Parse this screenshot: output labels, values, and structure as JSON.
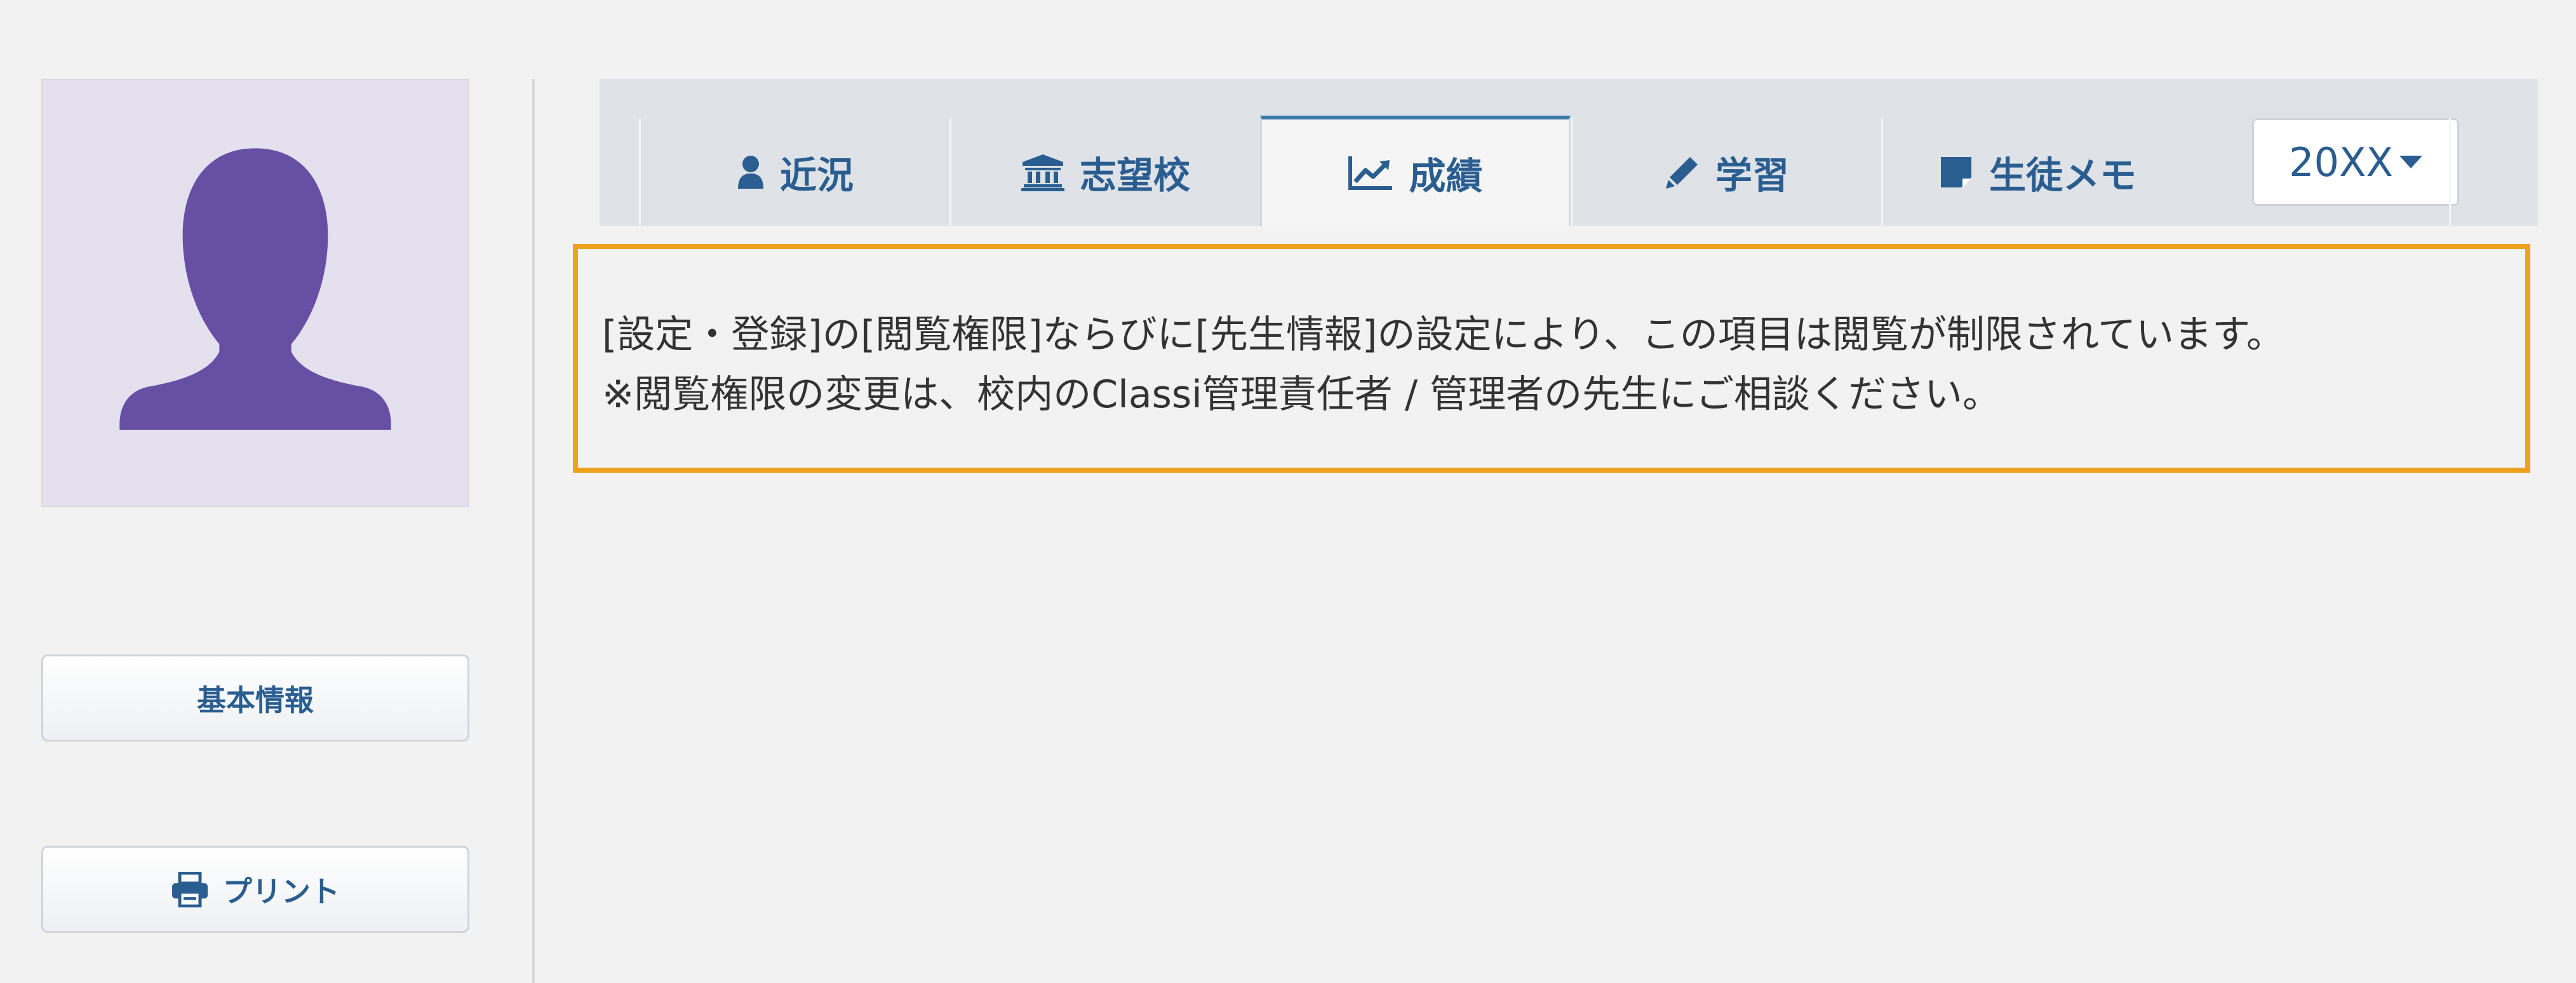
{
  "sidebar": {
    "avatar_icon": "person-silhouette-icon",
    "basic_info_label": "基本情報",
    "print_label": "プリント",
    "print_icon": "printer-icon"
  },
  "tabs": [
    {
      "label": "近況",
      "icon": "user-icon",
      "active": false
    },
    {
      "label": "志望校",
      "icon": "institution-icon",
      "active": false
    },
    {
      "label": "成績",
      "icon": "line-chart-icon",
      "active": true
    },
    {
      "label": "学習",
      "icon": "pencil-icon",
      "active": false
    },
    {
      "label": "生徒メモ",
      "icon": "sticky-note-icon",
      "active": false
    }
  ],
  "year_select": {
    "value": "20XX"
  },
  "notice": {
    "line1": "[設定・登録]の[閲覧権限]ならびに[先生情報]の設定により、この項目は閲覧が制限されています。",
    "line2": "※閲覧権限の変更は、校内のClassi管理責任者 / 管理者の先生にご相談ください。"
  },
  "colors": {
    "accent": "#2b5e90",
    "avatar_fill": "#6750a4",
    "avatar_bg": "#e4e0ee",
    "notice_border": "#efa11e",
    "active_tab_border": "#3d7aa8"
  }
}
